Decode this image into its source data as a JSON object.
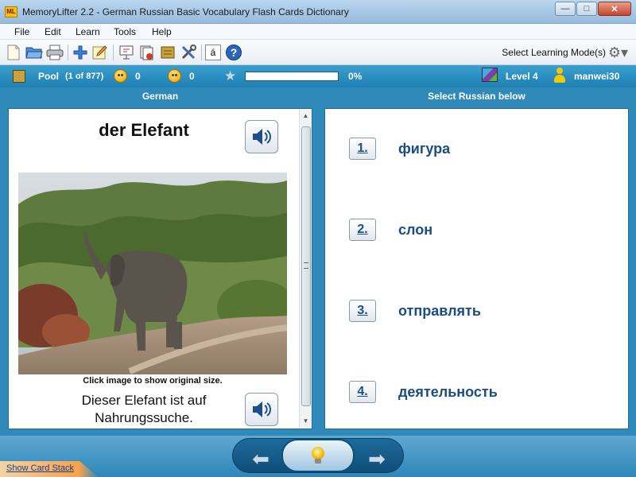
{
  "window": {
    "app_icon_text": "ML",
    "title": "MemoryLifter 2.2 - German Russian Basic Vocabulary Flash Cards Dictionary"
  },
  "menu": [
    "File",
    "Edit",
    "Learn",
    "Tools",
    "Help"
  ],
  "toolbar": {
    "icons": [
      "new-document-icon",
      "open-folder-icon",
      "print-icon",
      "add-card-icon",
      "edit-card-icon",
      "slideshow-icon",
      "card-stack-icon",
      "box-icon",
      "settings-tools-icon",
      "special-characters-icon",
      "help-icon"
    ],
    "special_char": "á",
    "help_char": "?",
    "mode_label": "Select Learning Mode(s)"
  },
  "status": {
    "pool_label": "Pool",
    "pool_count": "(1 of 877)",
    "correct_count": "0",
    "wrong_count": "0",
    "progress_text": "0%",
    "progress_fraction": 0,
    "level": "Level 4",
    "user": "manwei30"
  },
  "left": {
    "header": "German",
    "word": "der Elefant",
    "image_caption": "Click image to show original size.",
    "sentence": "Dieser Elefant ist auf Nahrungssuche."
  },
  "right": {
    "header": "Select Russian below",
    "answers": [
      {
        "num": "1.",
        "text": "фигура"
      },
      {
        "num": "2.",
        "text": "слон"
      },
      {
        "num": "3.",
        "text": "отправлять"
      },
      {
        "num": "4.",
        "text": "деятельность"
      }
    ]
  },
  "footer": {
    "show_card_stack": "Show Card Stack"
  },
  "colors": {
    "accent_blue": "#2f89b9",
    "answer_text": "#1a4d82"
  }
}
